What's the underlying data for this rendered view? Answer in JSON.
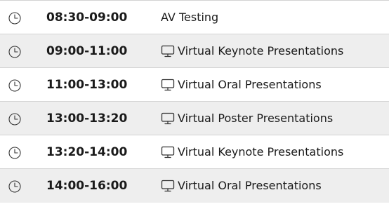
{
  "schedule": {
    "rows": [
      {
        "time": "08:30-09:00",
        "title": "AV Testing",
        "icons": [
          "clock-icon"
        ]
      },
      {
        "time": "09:00-11:00",
        "title": "Virtual Keynote Presentations",
        "icons": [
          "clock-icon",
          "monitor-icon"
        ]
      },
      {
        "time": "11:00-13:00",
        "title": "Virtual Oral Presentations",
        "icons": [
          "clock-icon",
          "monitor-icon"
        ]
      },
      {
        "time": "13:00-13:20",
        "title": "Virtual Poster Presentations",
        "icons": [
          "clock-icon",
          "monitor-icon"
        ]
      },
      {
        "time": "13:20-14:00",
        "title": "Virtual Keynote Presentations",
        "icons": [
          "clock-icon",
          "monitor-icon"
        ]
      },
      {
        "time": "14:00-16:00",
        "title": "Virtual Oral Presentations",
        "icons": [
          "clock-icon",
          "monitor-icon"
        ]
      }
    ]
  },
  "colors": {
    "row_alt_background": "#eeeeee",
    "divider": "#d3d3d3",
    "text": "#1a1a1a",
    "icon": "#333333"
  }
}
